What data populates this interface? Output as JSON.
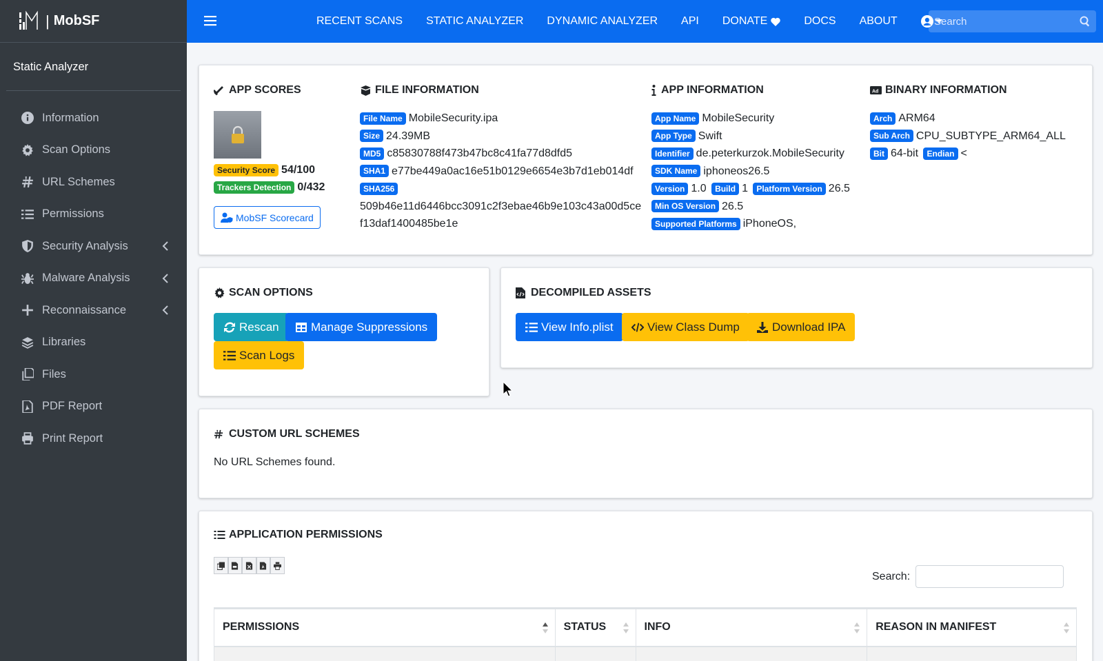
{
  "brand": {
    "name": "MobSF"
  },
  "sidebar": {
    "section": "Static Analyzer",
    "items": [
      {
        "label": "Information",
        "icon": "info-circle-icon"
      },
      {
        "label": "Scan Options",
        "icon": "gear-icon"
      },
      {
        "label": "URL Schemes",
        "icon": "hashtag-icon"
      },
      {
        "label": "Permissions",
        "icon": "list-icon"
      },
      {
        "label": "Security Analysis",
        "icon": "shield-icon",
        "expandable": true
      },
      {
        "label": "Malware Analysis",
        "icon": "bug-icon",
        "expandable": true
      },
      {
        "label": "Reconnaissance",
        "icon": "plus-icon",
        "expandable": true
      },
      {
        "label": "Libraries",
        "icon": "layers-icon"
      },
      {
        "label": "Files",
        "icon": "copy-icon"
      },
      {
        "label": "PDF Report",
        "icon": "file-pdf-icon"
      },
      {
        "label": "Print Report",
        "icon": "print-icon"
      }
    ]
  },
  "topnav": {
    "items": [
      "RECENT SCANS",
      "STATIC ANALYZER",
      "DYNAMIC ANALYZER",
      "API",
      "DONATE",
      "DOCS",
      "ABOUT"
    ],
    "search_placeholder": "Search"
  },
  "app_scores": {
    "title": "APP SCORES",
    "security_score_label": "Security Score",
    "security_score": "54/100",
    "trackers_label": "Trackers Detection",
    "trackers": "0/432",
    "scorecard_button": "MobSF Scorecard"
  },
  "file_info": {
    "title": "FILE INFORMATION",
    "file_name_label": "File Name",
    "file_name": "MobileSecurity.ipa",
    "size_label": "Size",
    "size": "24.39MB",
    "md5_label": "MD5",
    "md5": "c85830788f473b47bc8c41fa77d8dfd5",
    "sha1_label": "SHA1",
    "sha1": "e77be449a0ac16e51b0129e6654e3b7d1eb014df",
    "sha256_label": "SHA256",
    "sha256_line1": "509b46e11d6446bcc3091c2f3ebae46b9e103c43a00d5ce",
    "sha256_line2": "f13daf1400485be1e"
  },
  "app_info": {
    "title": "APP INFORMATION",
    "app_name_label": "App Name",
    "app_name": "MobileSecurity",
    "app_type_label": "App Type",
    "app_type": "Swift",
    "identifier_label": "Identifier",
    "identifier": "de.peterkurzok.MobileSecurity",
    "sdk_label": "SDK Name",
    "sdk": "iphoneos26.5",
    "version_label": "Version",
    "version": "1.0",
    "build_label": "Build",
    "build": "1",
    "platform_version_label": "Platform Version",
    "platform_version": "26.5",
    "min_os_label": "Min OS Version",
    "min_os": "26.5",
    "platforms_label": "Supported Platforms",
    "platforms": "iPhoneOS,"
  },
  "binary_info": {
    "title": "BINARY INFORMATION",
    "arch_label": "Arch",
    "arch": "ARM64",
    "sub_arch_label": "Sub Arch",
    "sub_arch": "CPU_SUBTYPE_ARM64_ALL",
    "bit_label": "Bit",
    "bit": "64-bit",
    "endian_label": "Endian",
    "endian": "<"
  },
  "scan_options": {
    "title": "SCAN OPTIONS",
    "rescan": "Rescan",
    "manage_suppressions": "Manage Suppressions",
    "scan_logs": "Scan Logs"
  },
  "decompiled": {
    "title": "DECOMPILED ASSETS",
    "view_info_plist": "View Info.plist",
    "view_class_dump": "View Class Dump",
    "download_ipa": "Download IPA"
  },
  "url_schemes": {
    "title": "CUSTOM URL SCHEMES",
    "empty": "No URL Schemes found."
  },
  "permissions": {
    "title": "APPLICATION PERMISSIONS",
    "search_label": "Search:",
    "columns": [
      "PERMISSIONS",
      "STATUS",
      "INFO",
      "REASON IN MANIFEST"
    ]
  },
  "colors": {
    "primary": "#0a6cf0",
    "sidebar": "#343a40",
    "info": "#17a2b8",
    "warning": "#ffc107",
    "success": "#28a745"
  }
}
